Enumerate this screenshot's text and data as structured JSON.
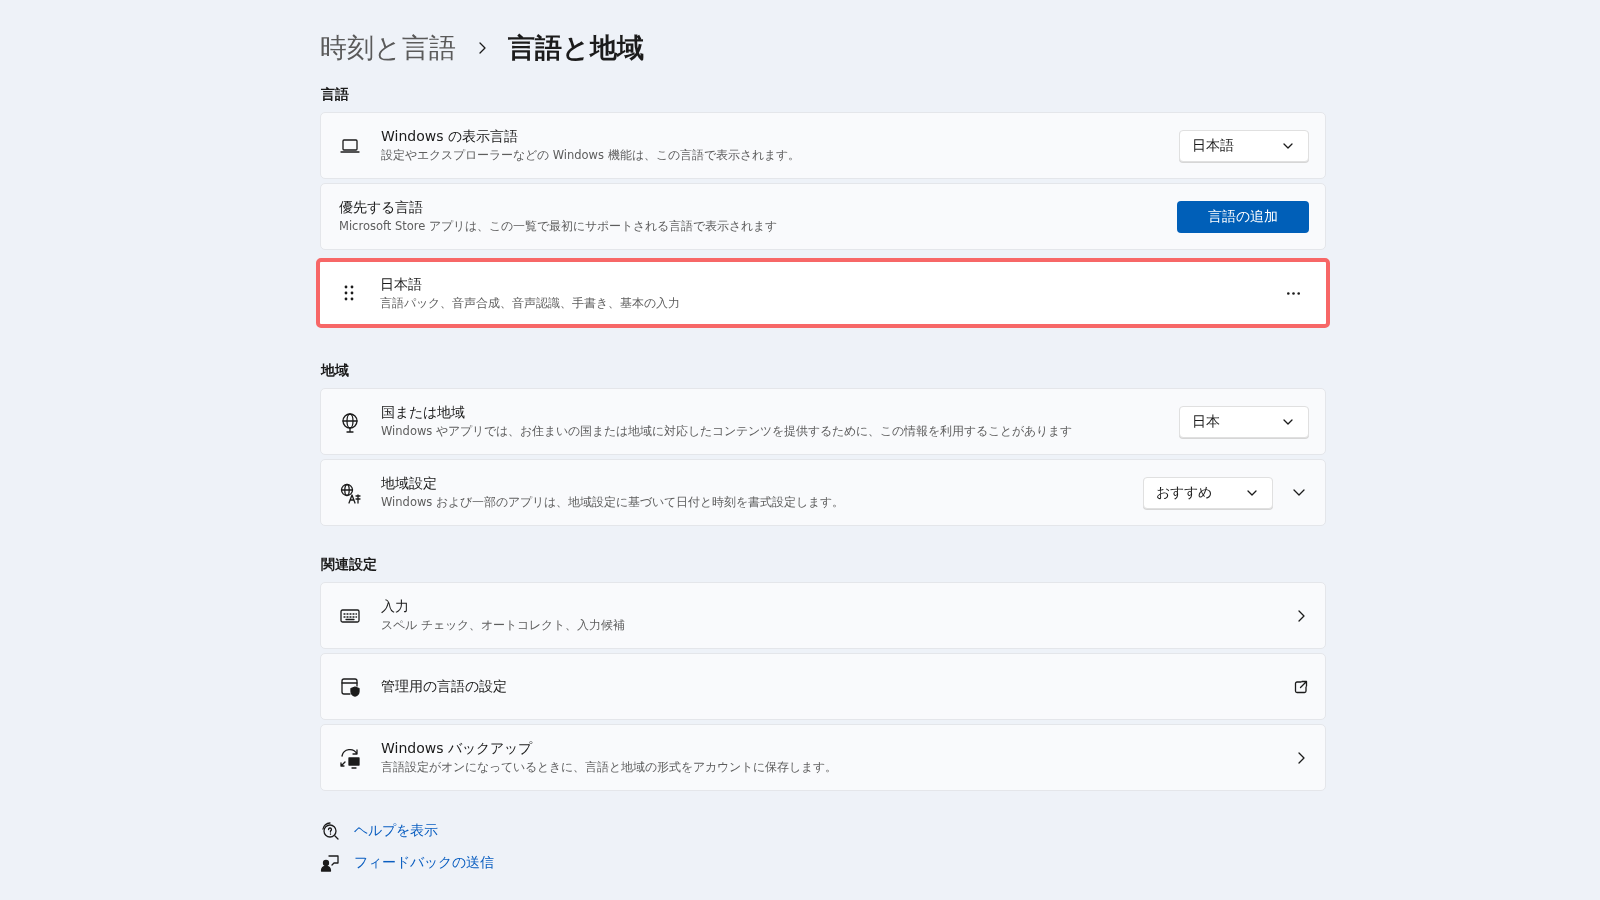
{
  "breadcrumb": {
    "parent": "時刻と言語",
    "current": "言語と地域"
  },
  "sections": [
    {
      "title": "言語",
      "rows": [
        {
          "kind": "dropdown",
          "title": "Windows の表示言語",
          "description": "設定やエクスプローラーなどの Windows 機能は、この言語で表示されます。",
          "value": "日本語"
        },
        {
          "kind": "button",
          "title": "優先する言語",
          "description": "Microsoft Store アプリは、この一覧で最初にサポートされる言語で表示されます",
          "button": "言語の追加"
        },
        {
          "kind": "language",
          "title": "日本語",
          "description": "言語パック、音声合成、音声認識、手書き、基本の入力",
          "highlighted": true
        }
      ]
    },
    {
      "title": "地域",
      "rows": [
        {
          "kind": "dropdown",
          "title": "国または地域",
          "description": "Windows やアプリでは、お住まいの国または地域に対応したコンテンツを提供するために、この情報を利用することがあります",
          "value": "日本"
        },
        {
          "kind": "dropdown",
          "title": "地域設定",
          "description": "Windows および一部のアプリは、地域設定に基づいて日付と時刻を書式設定します。",
          "value": "おすすめ",
          "expanded": false
        }
      ]
    },
    {
      "title": "関連設定",
      "rows": [
        {
          "kind": "link",
          "title": "入力",
          "description": "スペル チェック、オートコレクト、入力候補"
        },
        {
          "kind": "external",
          "title": "管理用の言語の設定"
        },
        {
          "kind": "link",
          "title": "Windows バックアップ",
          "description": "言語設定がオンになっているときに、言語と地域の形式をアカウントに保存します。"
        }
      ]
    }
  ],
  "footer_links": [
    "ヘルプを表示",
    "フィードバックの送信"
  ]
}
